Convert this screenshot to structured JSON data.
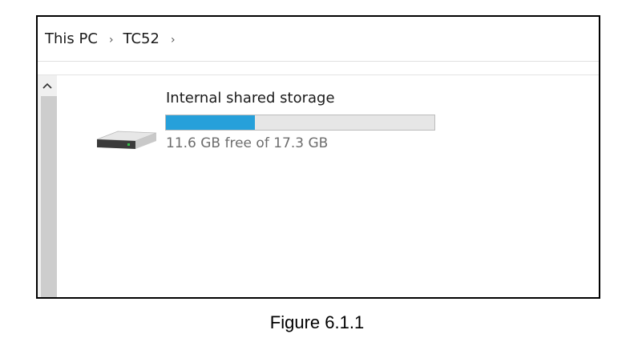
{
  "breadcrumb": {
    "items": [
      "This PC",
      "TC52"
    ]
  },
  "icons": {
    "separator": "chevron-right-icon",
    "scroll_up": "chevron-up-icon",
    "drive": "hard-drive-icon"
  },
  "drive": {
    "name": "Internal shared storage",
    "free_text": "11.6 GB free of 17.3 GB",
    "free_gb": 11.6,
    "total_gb": 17.3,
    "used_fraction": 0.33
  },
  "colors": {
    "progress_fill": "#26a0da",
    "progress_track": "#e6e6e6",
    "free_text": "#6d6d6d"
  },
  "caption": "Figure 6.1.1"
}
